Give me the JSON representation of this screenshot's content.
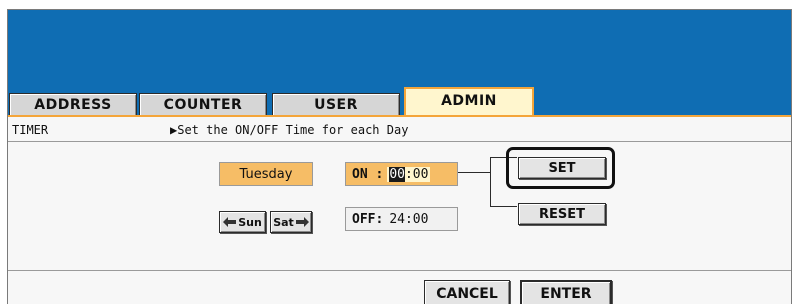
{
  "tabs": [
    {
      "label": "ADDRESS",
      "active": false
    },
    {
      "label": "COUNTER",
      "active": false
    },
    {
      "label": "USER",
      "active": false
    },
    {
      "label": "ADMIN",
      "active": true
    }
  ],
  "section": {
    "title": "TIMER",
    "instruction": "▶Set the ON/OFF Time for each Day"
  },
  "day_selector": {
    "day": "Tuesday",
    "prev_label": "Sun",
    "next_label": "Sat",
    "prev_icon": "left-arrow-icon",
    "next_icon": "right-arrow-icon"
  },
  "on_time": {
    "label": "ON :",
    "hour": "00",
    "separator": ":",
    "minute": "00"
  },
  "off_time": {
    "label": "OFF:",
    "hour": "24",
    "separator": ":",
    "minute": "00"
  },
  "buttons": {
    "set": "SET",
    "reset": "RESET",
    "cancel": "CANCEL",
    "enter": "ENTER"
  },
  "colors": {
    "header_blue": "#0f6db3",
    "accent_orange": "#f6bd66",
    "active_tab_bg": "#fff6ce"
  }
}
